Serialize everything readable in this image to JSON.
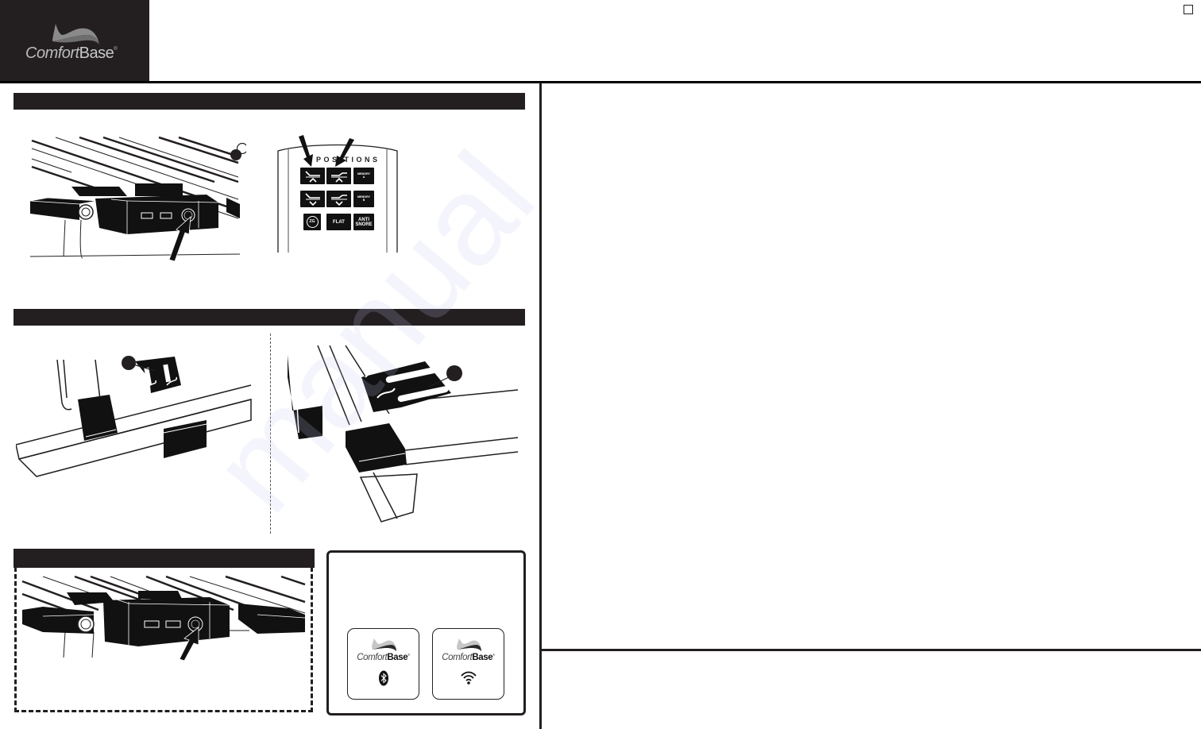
{
  "header": {
    "brand": {
      "light": "Comfort",
      "bold": "Base",
      "mark": "®"
    },
    "page_checkbox": {
      "checked": false
    }
  },
  "sections": [
    {
      "id": "section-1",
      "bar_label": ""
    },
    {
      "id": "section-2",
      "bar_label": ""
    },
    {
      "id": "section-3",
      "bar_label": ""
    }
  ],
  "remote": {
    "group_label": "POSITIONS",
    "buttons": [
      {
        "id": "head-up",
        "label": "",
        "icon": "head-up-icon"
      },
      {
        "id": "foot-up",
        "label": "",
        "icon": "foot-up-icon"
      },
      {
        "id": "memory-a",
        "label": "MEMORY A"
      },
      {
        "id": "head-down",
        "label": "",
        "icon": "head-down-icon"
      },
      {
        "id": "foot-down",
        "label": "",
        "icon": "foot-down-icon"
      },
      {
        "id": "memory-b",
        "label": "MEMORY B"
      },
      {
        "id": "zero-g",
        "label": "ZG"
      },
      {
        "id": "flat",
        "label": "FLAT"
      },
      {
        "id": "anti-snore",
        "label": "ANTI SNORE"
      }
    ]
  },
  "app_box": {
    "tiles": [
      {
        "brand_light": "Comfort",
        "brand_bold": "Base",
        "mark": "®",
        "icon": "bluetooth-icon"
      },
      {
        "brand_light": "Comfort",
        "brand_bold": "Base",
        "mark": "®",
        "icon": "wifi-icon"
      }
    ]
  },
  "watermark": "manual",
  "colors": {
    "ink": "#231f20",
    "paper": "#ffffff",
    "logo_grey": "#bcbcbc",
    "watermark": "#c8c8f5"
  }
}
